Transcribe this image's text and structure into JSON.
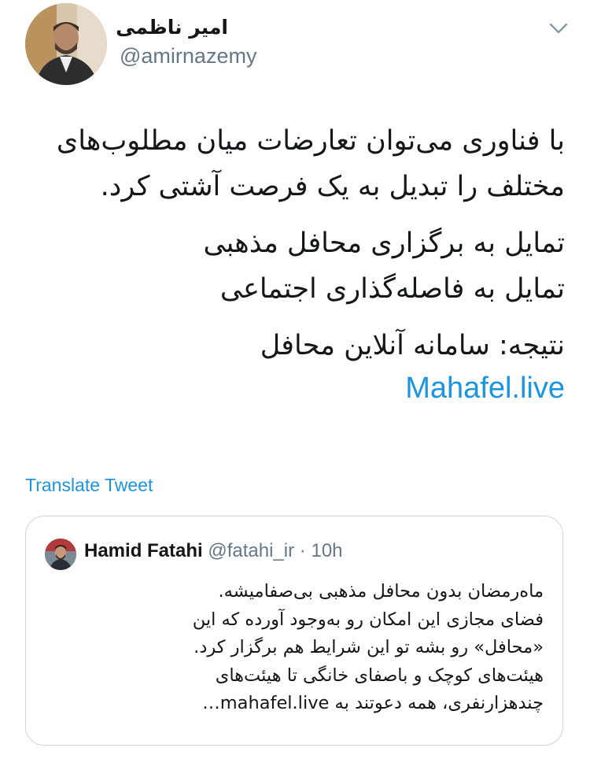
{
  "author": {
    "display_name": "امیر ناظمی",
    "handle": "@amirnazemy",
    "avatar_icon": "profile-photo"
  },
  "menu": {
    "icon": "chevron-down-icon"
  },
  "tweet": {
    "paragraph1": [
      "با فناوری می‌توان تعارضات میان مطلوب‌های",
      "مختلف را تبدیل به یک فرصت آشتی کرد."
    ],
    "paragraph2": [
      "تمایل به برگزاری محافل مذهبی",
      "تمایل به فاصله‌گذاری اجتماعی"
    ],
    "result": "نتیجه: سامانه آنلاین محافل",
    "link": "Mahafel.live"
  },
  "translate_label": "Translate Tweet",
  "quoted_tweet": {
    "name": "Hamid Fatahi",
    "handle": "@fatahi_ir",
    "separator": "·",
    "time": "10h",
    "lines": [
      "ماه‌رمضان بدون محافل مذهبی بی‌صفامیشه.",
      "فضای مجازی این امکان رو به‌وجود آورده که این",
      "«محافل» رو بشه تو این شرایط هم برگزار کرد.",
      "هیئت‌های کوچک و باصفای خانگی تا هیئت‌های",
      "چندهزارنفری، همه دعوتند به  mahafel.live…"
    ]
  },
  "colors": {
    "link": "#1b95e0",
    "secondary_text": "#657786",
    "border": "#ccd6dd",
    "primary_text": "#14171a"
  }
}
